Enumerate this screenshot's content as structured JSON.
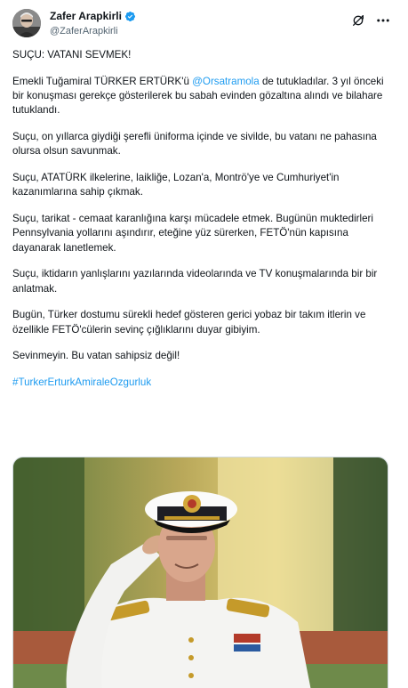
{
  "author": {
    "display_name": "Zafer Arapkirli",
    "handle": "@ZaferArapkirli",
    "verified": true,
    "avatar_icon": "user-avatar"
  },
  "header_actions": {
    "grok_icon": "grok-icon",
    "more_icon": "more-horizontal-icon"
  },
  "tweet": {
    "p1": "SUÇU: VATANI SEVMEK!",
    "p2_before": "Emekli Tuğamiral TÜRKER ERTÜRK'ü ",
    "p2_mention": "@Orsatramola",
    "p2_after": " de tutukladılar. 3 yıl önceki bir konuşması gerekçe gösterilerek bu sabah evinden gözaltına alındı ve bilahare tutuklandı.",
    "p3": "Suçu, on yıllarca giydiği şerefli üniforma içinde ve sivilde, bu vatanı ne pahasına olursa olsun savunmak.",
    "p4": "Suçu, ATATÜRK ilkelerine, laikliğe, Lozan'a, Montrö'ye ve Cumhuriyet'in kazanımlarına sahip çıkmak.",
    "p5": "Suçu, tarikat - cemaat karanlığına karşı mücadele etmek. Bugünün muktedirleri Pennsylvania yollarını aşındırır, eteğine yüz sürerken, FETÖ'nün kapısına dayanarak lanetlemek.",
    "p6": "Suçu, iktidarın yanlışlarını yazılarında videolarında ve TV konuşmalarında bir bir anlatmak.",
    "p7": "Bugün, Türker dostumu sürekli hedef gösteren gerici yobaz bir takım itlerin  ve özellikle  FETÖ'cülerin sevinç çığlıklarını duyar gibiyim.",
    "p8": "Sevinmeyin. Bu vatan sahipsiz değil!",
    "hashtag": "#TurkerErturkAmiraleOzgurluk"
  },
  "media": {
    "type": "photo",
    "description_icon": "saluting-naval-officer-photo"
  },
  "colors": {
    "link": "#1d9bf0",
    "text": "#0f1419",
    "secondary": "#536471",
    "verified": "#1d9bf0"
  }
}
